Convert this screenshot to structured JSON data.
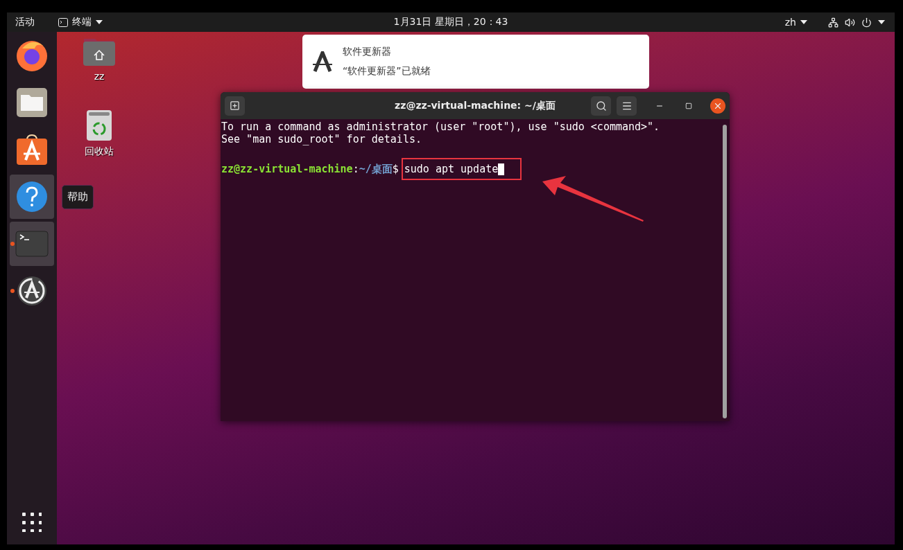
{
  "top_bar": {
    "activities": "活动",
    "app_menu": "终端",
    "clock": "1月31日 星期日，20：43",
    "input_method": "zh"
  },
  "dock": {
    "items": [
      {
        "kind": "firefox",
        "highlighted": false,
        "running": false
      },
      {
        "kind": "files",
        "highlighted": false,
        "running": false
      },
      {
        "kind": "software",
        "highlighted": false,
        "running": false
      },
      {
        "kind": "help",
        "highlighted": true,
        "running": false
      },
      {
        "kind": "terminal",
        "highlighted": true,
        "running": true
      },
      {
        "kind": "updater",
        "highlighted": false,
        "running": true
      }
    ]
  },
  "tooltip": "帮助",
  "desktop_icons": [
    {
      "kind": "home",
      "label": "zz"
    },
    {
      "kind": "trash",
      "label": "回收站"
    }
  ],
  "notification": {
    "title": "软件更新器",
    "body": "“软件更新器”已就绪"
  },
  "terminal": {
    "title": "zz@zz-virtual-machine: ~/桌面",
    "lines": [
      "To run a command as administrator (user \"root\"), use \"sudo <command>\".",
      "See \"man sudo_root\" for details."
    ],
    "prompt": {
      "user_host": "zz@zz-virtual-machine",
      "separator": ":",
      "path": "~/桌面",
      "symbol": "$",
      "command": "sudo apt update"
    }
  }
}
